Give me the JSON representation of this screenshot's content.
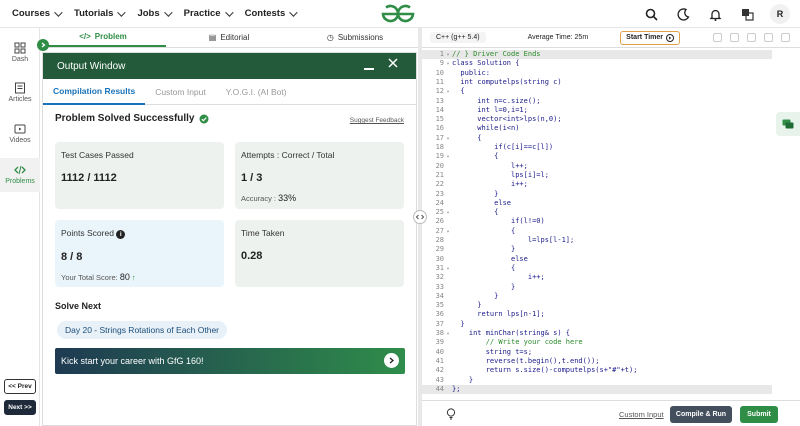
{
  "nav": {
    "items": [
      "Courses",
      "Tutorials",
      "Jobs",
      "Practice",
      "Contests"
    ],
    "avatar_letter": "R"
  },
  "left_sidebar": {
    "items": [
      "Dash",
      "Articles",
      "Videos",
      "Problems"
    ],
    "active": "Problems",
    "prev_label": "<< Prev",
    "next_label": "Next >>"
  },
  "problem_tabs": {
    "tabs": [
      "Problem",
      "Editorial",
      "Submissions"
    ],
    "active": "Problem"
  },
  "output_window": {
    "title": "Output Window",
    "tabs": [
      "Compilation Results",
      "Custom Input",
      "Y.O.G.I. (AI Bot)"
    ],
    "active_tab": "Compilation Results",
    "status": "Problem Solved Successfully",
    "suggest_feedback": "Suggest Feedback",
    "test_cases": {
      "label": "Test Cases Passed",
      "value": "1112 / 1112"
    },
    "attempts": {
      "label": "Attempts : Correct / Total",
      "value": "1 / 3",
      "accuracy_label": "Accuracy :",
      "accuracy": "33%"
    },
    "points": {
      "label": "Points Scored",
      "value": "8 / 8",
      "total_label": "Your Total Score:",
      "total": "80"
    },
    "time_taken": {
      "label": "Time Taken",
      "value": "0.28"
    },
    "solve_next": "Solve Next",
    "next_problem": "Day 20 - Strings Rotations of Each Other",
    "banner": "Kick start your career with GfG 160!"
  },
  "editor": {
    "language": "C++ (g++ 5.4)",
    "avg_time": "Average Time: 25m",
    "start_timer": "Start Timer",
    "lines": [
      {
        "n": 1,
        "fold": true,
        "text": "// } Driver Code Ends",
        "hl": true
      },
      {
        "n": 9,
        "fold": true,
        "text": "class Solution {"
      },
      {
        "n": 10,
        "fold": false,
        "text": "  public:"
      },
      {
        "n": 11,
        "fold": false,
        "text": "  int computelps(string c)"
      },
      {
        "n": 12,
        "fold": true,
        "text": "  {"
      },
      {
        "n": 13,
        "fold": false,
        "text": "      int n=c.size();"
      },
      {
        "n": 14,
        "fold": false,
        "text": "      int l=0,i=1;"
      },
      {
        "n": 15,
        "fold": false,
        "text": "      vector<int>lps(n,0);"
      },
      {
        "n": 16,
        "fold": false,
        "text": "      while(i<n)"
      },
      {
        "n": 17,
        "fold": true,
        "text": "      {"
      },
      {
        "n": 18,
        "fold": false,
        "text": "          if(c[i]==c[l])"
      },
      {
        "n": 19,
        "fold": true,
        "text": "          {"
      },
      {
        "n": 20,
        "fold": false,
        "text": "              l++;"
      },
      {
        "n": 21,
        "fold": false,
        "text": "              lps[i]=l;"
      },
      {
        "n": 22,
        "fold": false,
        "text": "              i++;"
      },
      {
        "n": 23,
        "fold": false,
        "text": "          }"
      },
      {
        "n": 24,
        "fold": false,
        "text": "          else"
      },
      {
        "n": 25,
        "fold": true,
        "text": "          {"
      },
      {
        "n": 26,
        "fold": false,
        "text": "              if(l!=0)"
      },
      {
        "n": 27,
        "fold": true,
        "text": "              {"
      },
      {
        "n": 28,
        "fold": false,
        "text": "                  l=lps[l-1];"
      },
      {
        "n": 29,
        "fold": false,
        "text": "              }"
      },
      {
        "n": 30,
        "fold": false,
        "text": "              else"
      },
      {
        "n": 31,
        "fold": true,
        "text": "              {"
      },
      {
        "n": 32,
        "fold": false,
        "text": "                  i++;"
      },
      {
        "n": 33,
        "fold": false,
        "text": "              }"
      },
      {
        "n": 34,
        "fold": false,
        "text": "          }"
      },
      {
        "n": 35,
        "fold": false,
        "text": "      }"
      },
      {
        "n": 36,
        "fold": false,
        "text": "      return lps[n-1];"
      },
      {
        "n": 37,
        "fold": false,
        "text": "  }"
      },
      {
        "n": 38,
        "fold": true,
        "text": "    int minChar(string& s) {"
      },
      {
        "n": 39,
        "fold": false,
        "text": "        // Write your code here"
      },
      {
        "n": 40,
        "fold": false,
        "text": "        string t=s;"
      },
      {
        "n": 41,
        "fold": false,
        "text": "        reverse(t.begin(),t.end());"
      },
      {
        "n": 42,
        "fold": false,
        "text": "        return s.size()-computelps(s+\"#\"+t);"
      },
      {
        "n": 43,
        "fold": false,
        "text": "    }"
      },
      {
        "n": 44,
        "fold": false,
        "text": "};",
        "hl": true
      }
    ],
    "custom_input": "Custom Input",
    "compile_run": "Compile & Run",
    "submit": "Submit"
  },
  "colors": {
    "brand_green": "#2f8d46",
    "output_header": "#235a3a"
  }
}
